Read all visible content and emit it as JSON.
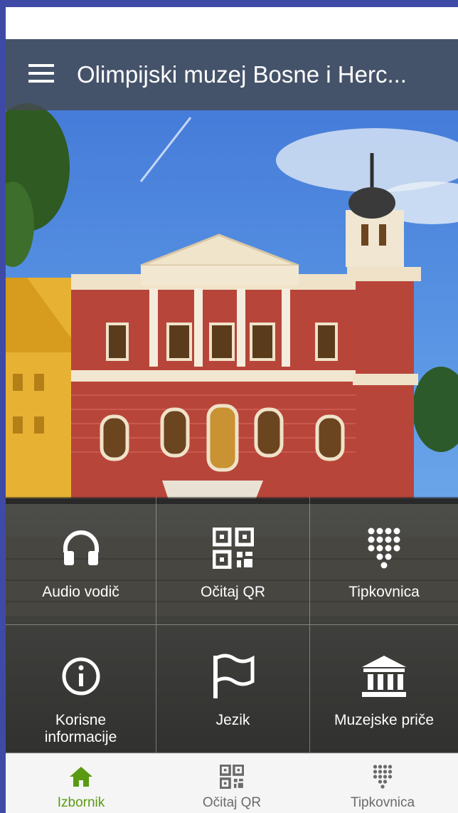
{
  "app_bar": {
    "title": "Olimpijski muzej Bosne i Herc...",
    "menu_icon": "hamburger-menu-icon"
  },
  "tiles": [
    {
      "label": "Audio vodič",
      "icon": "headphones-icon"
    },
    {
      "label": "Očitaj QR",
      "icon": "qr-code-icon"
    },
    {
      "label": "Tipkovnica",
      "icon": "keypad-icon"
    },
    {
      "label": "Korisne informacije",
      "icon": "info-icon"
    },
    {
      "label": "Jezik",
      "icon": "flag-icon"
    },
    {
      "label": "Muzejske priče",
      "icon": "museum-icon"
    }
  ],
  "bottom_nav": {
    "items": [
      {
        "label": "Izbornik",
        "icon": "home-icon",
        "active": true
      },
      {
        "label": "Očitaj QR",
        "icon": "qr-code-icon",
        "active": false
      },
      {
        "label": "Tipkovnica",
        "icon": "keypad-icon",
        "active": false
      }
    ]
  },
  "colors": {
    "accent_active": "#5a9a12",
    "inactive": "#6b6b6b",
    "app_bar": "#464a52",
    "frame_border": "#3f4aa6"
  }
}
